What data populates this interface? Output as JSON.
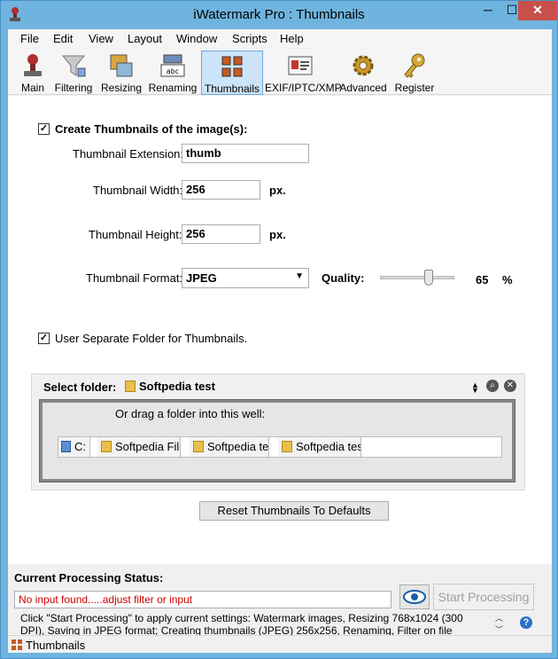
{
  "window": {
    "title": "iWatermark Pro : Thumbnails",
    "controls": {
      "minimize": "─",
      "maximize": "☐",
      "close": "✕"
    }
  },
  "menu": [
    "File",
    "Edit",
    "View",
    "Layout",
    "Window",
    "Scripts",
    "Help"
  ],
  "toolbar": {
    "items": [
      {
        "label": "Main",
        "icon": "stamp-icon"
      },
      {
        "label": "Filtering",
        "icon": "funnel-icon"
      },
      {
        "label": "Resizing",
        "icon": "resize-icon"
      },
      {
        "label": "Renaming",
        "icon": "rename-icon"
      },
      {
        "label": "Thumbnails",
        "icon": "thumbnails-icon",
        "active": true
      },
      {
        "label": "EXIF/IPTC/XMP",
        "icon": "id-card-icon"
      },
      {
        "label": "Advanced",
        "icon": "gear-icon"
      },
      {
        "label": "Register",
        "icon": "key-icon"
      }
    ]
  },
  "thumbnails": {
    "create_label": "Create Thumbnails of the image(s):",
    "create_checked": true,
    "extension_label": "Thumbnail Extension:",
    "extension_value": "thumb",
    "width_label": "Thumbnail Width:",
    "width_value": "256",
    "width_unit": "px.",
    "height_label": "Thumbnail Height:",
    "height_value": "256",
    "height_unit": "px.",
    "format_label": "Thumbnail Format:",
    "format_value": "JPEG",
    "quality_label": "Quality:",
    "quality_value": "65",
    "quality_unit": "%",
    "quality_fraction": 0.65,
    "separate_folder_label": "User Separate Folder for Thumbnails.",
    "separate_folder_checked": true
  },
  "folder": {
    "select_label": "Select folder:",
    "selected": "Softpedia test",
    "drag_hint": "Or drag a folder into this well:",
    "path": [
      "C:",
      "Softpedia File",
      "Softpedia tes",
      "Softpedia tes"
    ]
  },
  "reset_button": "Reset Thumbnails To Defaults",
  "status": {
    "title": "Current Processing Status:",
    "message": "No input found.....adjust filter or input",
    "start_button": "Start Processing",
    "description": "Click \"Start Processing\" to apply current settings: Watermark images, Resizing 768x1024 (300 DPI), Saving in JPEG format; Creating thumbnails (JPEG) 256x256, Renaming, Filter on file attributes: Filename Constants: DSC;"
  },
  "statusbar": {
    "label": "Thumbnails"
  },
  "colors": {
    "titlebar": "#6fb4de",
    "close": "#c7504a",
    "error_text": "#cc0000",
    "active_tool": "#cce4f7"
  }
}
